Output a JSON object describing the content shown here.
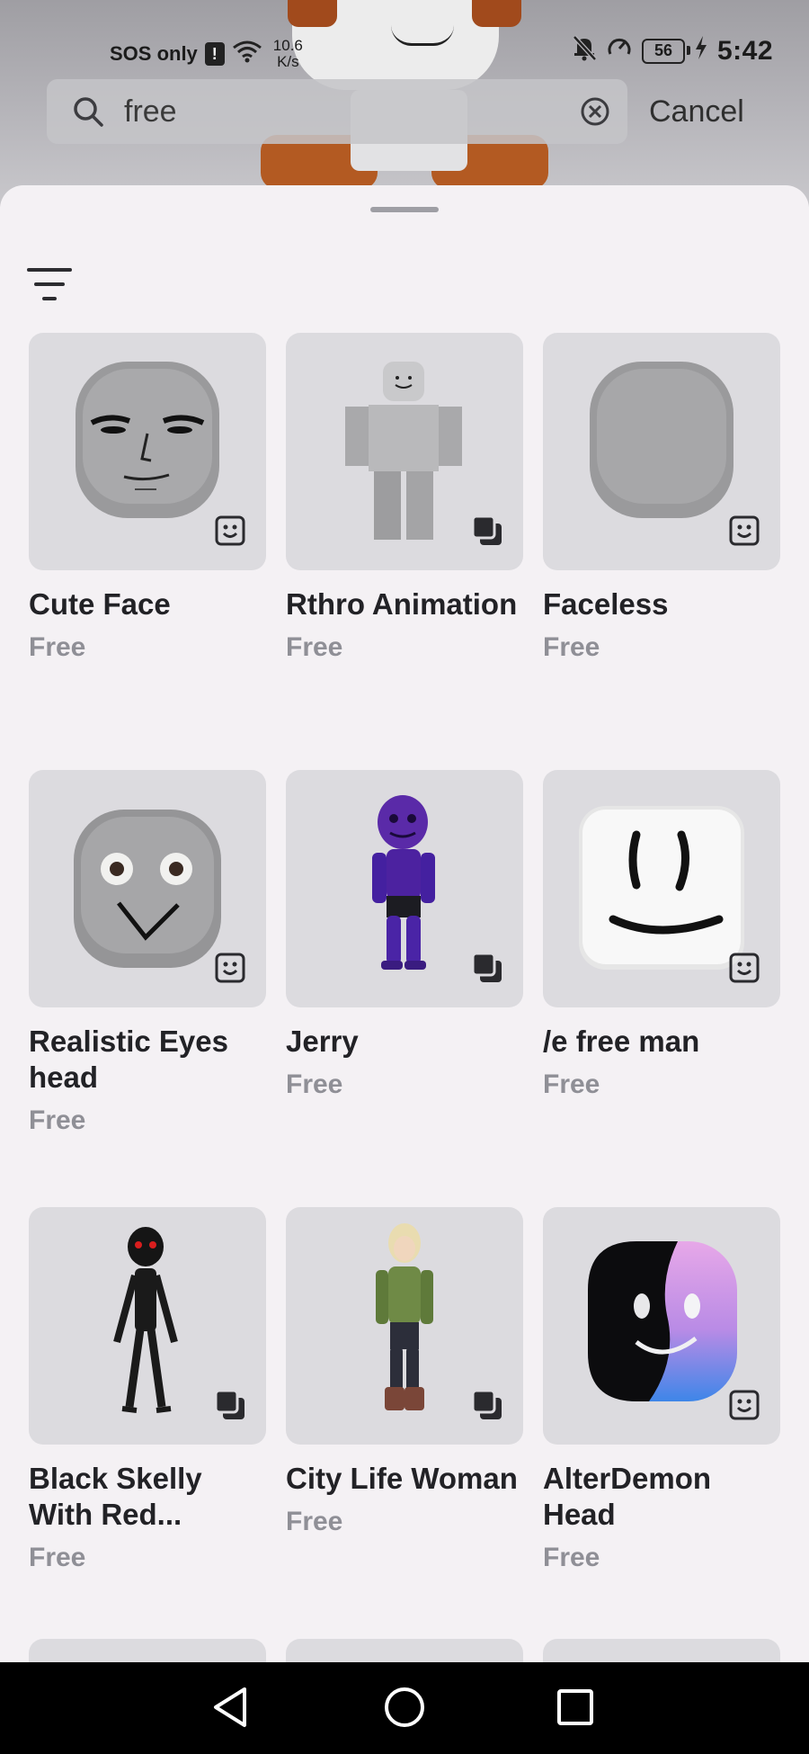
{
  "status_bar": {
    "carrier": "SOS only",
    "alert": "!",
    "speed_value": "10.6",
    "speed_unit": "K/s",
    "battery": "56",
    "time": "5:42"
  },
  "search": {
    "query": "free",
    "cancel_label": "Cancel"
  },
  "results": [
    {
      "name": "Cute Face",
      "price": "Free",
      "type_icon": "face-icon"
    },
    {
      "name": "Rthro Animation",
      "price": "Free",
      "type_icon": "bundle-icon"
    },
    {
      "name": "Faceless",
      "price": "Free",
      "type_icon": "face-icon"
    },
    {
      "name": "Realistic Eyes head",
      "price": "Free",
      "type_icon": "face-icon"
    },
    {
      "name": "Jerry",
      "price": "Free",
      "type_icon": "bundle-icon"
    },
    {
      "name": "/e free man",
      "price": "Free",
      "type_icon": "face-icon"
    },
    {
      "name": "Black Skelly With Red...",
      "price": "Free",
      "type_icon": "bundle-icon"
    },
    {
      "name": "City Life Woman",
      "price": "Free",
      "type_icon": "bundle-icon"
    },
    {
      "name": "AlterDemon Head",
      "price": "Free",
      "type_icon": "face-icon"
    }
  ],
  "colors": {
    "sheet_background": "#f4f1f4",
    "thumbnail_background": "#dcdbdf",
    "price_text": "#8f8f96",
    "title_text": "#222226"
  }
}
